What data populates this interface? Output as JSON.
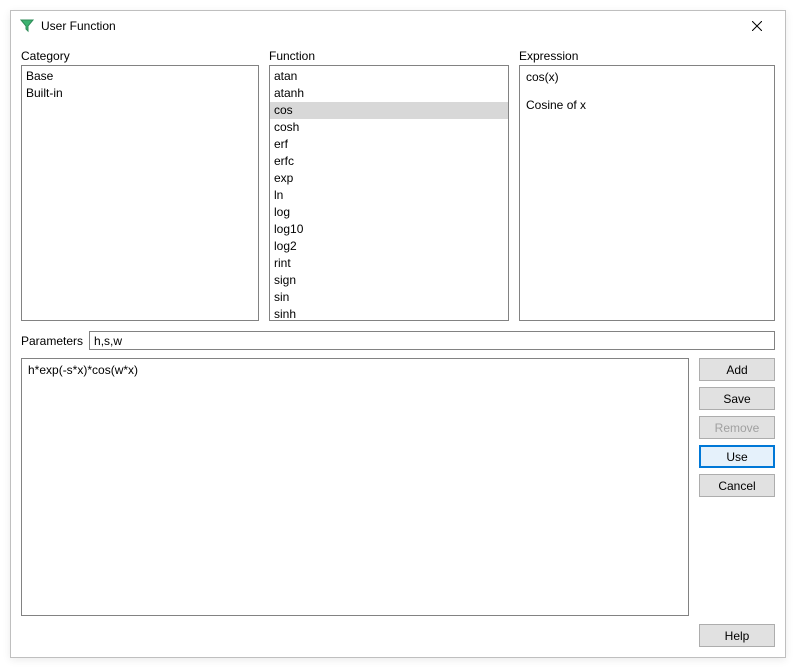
{
  "window": {
    "title": "User Function"
  },
  "labels": {
    "category": "Category",
    "function": "Function",
    "expression": "Expression",
    "parameters": "Parameters"
  },
  "category": {
    "items": [
      "Base",
      "Built-in"
    ],
    "selected_index": -1
  },
  "function": {
    "items": [
      "atan",
      "atanh",
      "cos",
      "cosh",
      "erf",
      "erfc",
      "exp",
      "ln",
      "log",
      "log10",
      "log2",
      "rint",
      "sign",
      "sin",
      "sinh"
    ],
    "selected_index": 2
  },
  "expression_panel": {
    "formula": "cos(x)",
    "description": "Cosine of x"
  },
  "parameters": {
    "value": "h,s,w"
  },
  "user_expression": {
    "value": "h*exp(-s*x)*cos(w*x)"
  },
  "buttons": {
    "add": "Add",
    "save": "Save",
    "remove": "Remove",
    "use": "Use",
    "cancel": "Cancel",
    "help": "Help"
  },
  "icons": {
    "app": "funnel-icon",
    "close": "close-icon"
  }
}
